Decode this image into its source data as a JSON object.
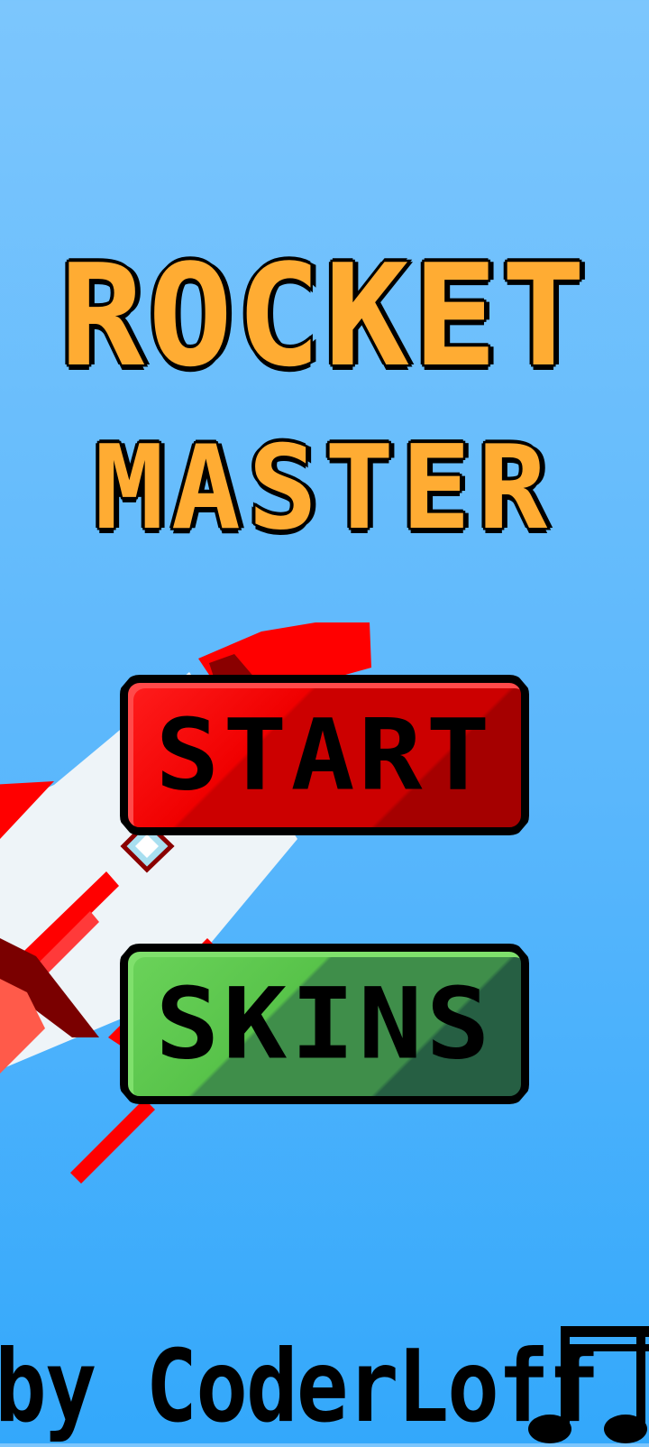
{
  "title": {
    "line1": "ROCKET",
    "line2": "MASTER"
  },
  "menu": {
    "start_label": "START",
    "skins_label": "SKINS"
  },
  "credit": {
    "text": "by CoderLoff"
  },
  "icons": {
    "music": "music-note-icon"
  },
  "colors": {
    "sky_top": "#7cc6fd",
    "sky_bottom": "#33a8fb",
    "title": "#ffac33",
    "start_button": "#cc0000",
    "skins_button": "#3f8e4a",
    "rocket_body": "#eef4f8",
    "rocket_red": "#ff0000"
  }
}
